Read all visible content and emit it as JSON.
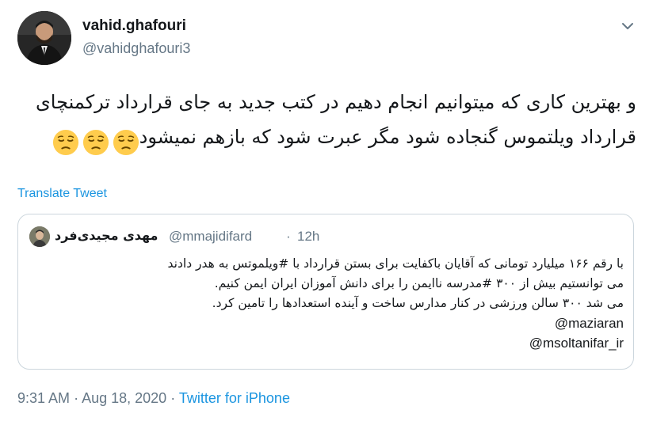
{
  "author": {
    "display_name": "vahid.ghafouri",
    "handle": "@vahidghafouri3"
  },
  "tweet": {
    "text": "و بهترین کاری که میتوانیم انجام دهیم در کتب جدید به جای قرارداد ترکمنچای قرارداد ویلتموس گنجاده شود مگر عبرت شود که بازهم نمیشود",
    "emojis": [
      "pensive-face",
      "pensive-face",
      "pensive-face"
    ],
    "translate_label": "Translate Tweet"
  },
  "quote": {
    "display_name": "مهدی مجیدی‌فرد",
    "handle": "@mmajidifard",
    "separator": "·",
    "time": "12h",
    "lines": [
      "با رقم ۱۶۶ میلیارد تومانی که آقایان باکفایت برای بستن قرارداد با #ویلموتس به هدر دادند",
      "می توانستیم بیش از ۳۰۰ #مدرسه ناایمن را برای دانش آموزان ایران ایمن کنیم.",
      "می شد ۳۰۰ سالن ورزشی در کنار مدارس ساخت و آینده استعدادها را تامین کرد."
    ],
    "mentions": [
      "@maziaran",
      "@msoltanifar_ir"
    ]
  },
  "footer": {
    "time": "9:31 AM",
    "separator1": "·",
    "date": "Aug 18, 2020",
    "separator2": "·",
    "source": "Twitter for iPhone"
  },
  "colors": {
    "link": "#1b95e0",
    "muted": "#657786",
    "border": "#ccd6dd",
    "text": "#14171a"
  },
  "icons": {
    "caret": "chevron-down-icon",
    "emoji": "pensive-face-emoji-icon"
  }
}
